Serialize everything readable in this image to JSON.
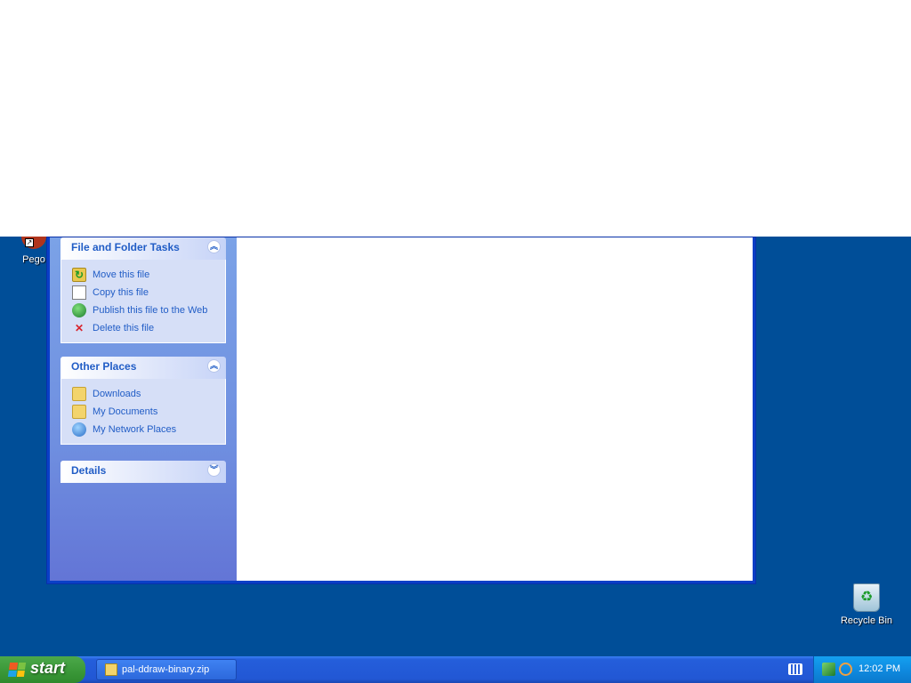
{
  "desktop": {
    "icons": [
      {
        "label": "Pego"
      },
      {
        "label": "Recycle Bin"
      }
    ]
  },
  "explorer": {
    "file_tasks": {
      "title": "File and Folder Tasks",
      "items": [
        "Move this file",
        "Copy this file",
        "Publish this file to the Web",
        "Delete this file"
      ]
    },
    "other_places": {
      "title": "Other Places",
      "items": [
        "Downloads",
        "My Documents",
        "My Network Places"
      ]
    },
    "details": {
      "title": "Details"
    }
  },
  "taskbar": {
    "start_label": "start",
    "task_button_label": "pal-ddraw-binary.zip",
    "clock": "12:02 PM"
  },
  "colors": {
    "desktop_bg": "#004e98",
    "taskbar_blue": "#245edb",
    "start_green": "#3c9a3a",
    "link_blue": "#215dc6"
  }
}
